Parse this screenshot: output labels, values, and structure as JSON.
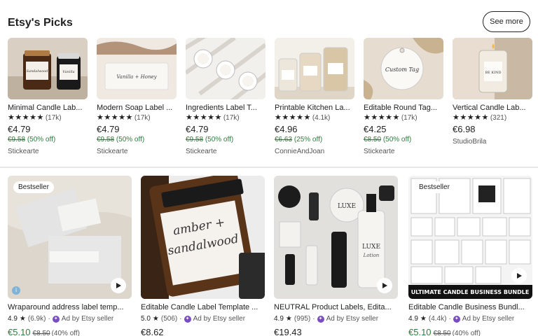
{
  "section": {
    "title": "Etsy's Picks",
    "see_more": "See more"
  },
  "picks": [
    {
      "title": "Minimal Candle Lab...",
      "stars": "★★★★★",
      "count": "(17k)",
      "price": "€4.79",
      "orig": "€9.58",
      "pct": "(50% off)",
      "shop": "Stickearte"
    },
    {
      "title": "Modern Soap Label ...",
      "stars": "★★★★★",
      "count": "(17k)",
      "price": "€4.79",
      "orig": "€9.58",
      "pct": "(50% off)",
      "shop": "Stickearte"
    },
    {
      "title": "Ingredients Label T...",
      "stars": "★★★★★",
      "count": "(17k)",
      "price": "€4.79",
      "orig": "€9.58",
      "pct": "(50% off)",
      "shop": "Stickearte"
    },
    {
      "title": "Printable Kitchen La...",
      "stars": "★★★★★",
      "count": "(4.1k)",
      "price": "€4.96",
      "orig": "€6.63",
      "pct": "(25% off)",
      "shop": "ConnieAndJoan"
    },
    {
      "title": "Editable Round Tag...",
      "stars": "★★★★★",
      "count": "(17k)",
      "price": "€4.25",
      "orig": "€8.50",
      "pct": "(50% off)",
      "shop": "Stickearte"
    },
    {
      "title": "Vertical Candle Lab...",
      "stars": "★★★★★",
      "count": "(321)",
      "price": "€6.98",
      "orig": "",
      "pct": "",
      "shop": "StudioBrila"
    }
  ],
  "pick_images": [
    {
      "text": "Candle jars",
      "alt": "Sandalwood Vanilla"
    },
    {
      "text": "Vanilla + Honey",
      "alt": ""
    },
    {
      "text": "Tin labels",
      "alt": ""
    },
    {
      "text": "Kitchen jars",
      "alt": ""
    },
    {
      "text": "Custom Tag",
      "alt": ""
    },
    {
      "text": "BE KIND",
      "alt": ""
    }
  ],
  "ads": [
    {
      "title": "Wraparound address label temp...",
      "badge": "Bestseller",
      "rating": "4.9",
      "count": "(6.9k)",
      "ad_text": "Ad by Etsy seller",
      "sale": "€5.10",
      "orig": "€8.50",
      "pct": "(40% off)",
      "plain": ""
    },
    {
      "title": "Editable Candle Label Template ...",
      "badge": "",
      "rating": "5.0",
      "count": "(506)",
      "ad_text": "Ad by Etsy seller",
      "sale": "",
      "orig": "",
      "pct": "",
      "plain": "€8.62"
    },
    {
      "title": "NEUTRAL Product Labels, Edita...",
      "badge": "",
      "rating": "4.9",
      "count": "(995)",
      "ad_text": "Ad by Etsy seller",
      "sale": "",
      "orig": "",
      "pct": "",
      "plain": "€19.43"
    },
    {
      "title": "Editable Candle Business Bundl...",
      "badge": "Bestseller",
      "rating": "4.9",
      "count": "(4.4k)",
      "ad_text": "Ad by Etsy seller",
      "sale": "€5.10",
      "orig": "€8.50",
      "pct": "(40% off)",
      "plain": ""
    }
  ],
  "ad_images": [
    {
      "line1": "",
      "line2": ""
    },
    {
      "line1": "amber +",
      "line2": "sandalwood"
    },
    {
      "line1": "LUXE",
      "line2": "Lotion"
    },
    {
      "line1": "ULTIMATE CANDLE BUSINESS BUNDLE",
      "line2": ""
    }
  ],
  "colors": {
    "green": "#2d7d3c",
    "text": "#222222",
    "muted": "#555555",
    "ad_purple": "#7a4cc2"
  }
}
